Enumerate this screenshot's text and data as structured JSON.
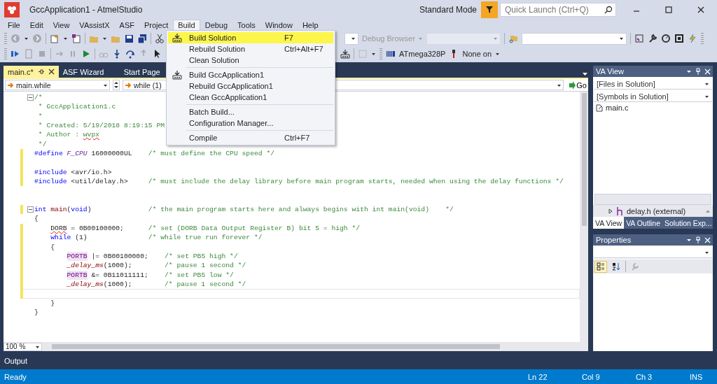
{
  "window": {
    "title": "GccApplication1 - AtmelStudio",
    "mode": "Standard Mode",
    "quick_launch": {
      "placeholder": "Quick Launch (Ctrl+Q)"
    }
  },
  "menu": [
    {
      "label": "File",
      "selected": false
    },
    {
      "label": "Edit",
      "selected": false
    },
    {
      "label": "View",
      "selected": false
    },
    {
      "label": "VAssistX",
      "selected": false
    },
    {
      "label": "ASF",
      "selected": false
    },
    {
      "label": "Project",
      "selected": false
    },
    {
      "label": "Build",
      "selected": true
    },
    {
      "label": "Debug",
      "selected": false
    },
    {
      "label": "Tools",
      "selected": false
    },
    {
      "label": "Window",
      "selected": false
    },
    {
      "label": "Help",
      "selected": false
    }
  ],
  "build_menu": [
    {
      "kind": "icon-item",
      "label": "Build Solution",
      "shortcut": "F7",
      "selected": true
    },
    {
      "kind": "item",
      "label": "Rebuild Solution",
      "shortcut": "Ctrl+Alt+F7",
      "selected": false
    },
    {
      "kind": "item",
      "label": "Clean Solution",
      "selected": false
    },
    {
      "kind": "separator"
    },
    {
      "kind": "icon-item",
      "label": "Build GccApplication1",
      "selected": false
    },
    {
      "kind": "item",
      "label": "Rebuild GccApplication1",
      "selected": false
    },
    {
      "kind": "item",
      "label": "Clean GccApplication1",
      "selected": false
    },
    {
      "kind": "separator"
    },
    {
      "kind": "item",
      "label": "Batch Build...",
      "selected": false
    },
    {
      "kind": "item",
      "label": "Configuration Manager...",
      "selected": false
    },
    {
      "kind": "separator"
    },
    {
      "kind": "item",
      "label": "Compile",
      "shortcut": "Ctrl+F7",
      "selected": false
    }
  ],
  "toolbar": {
    "debug_browser": "Debug Browser",
    "device": "ATmega328P",
    "tool": "None on"
  },
  "document_tabs": [
    {
      "label": "main.c*",
      "selected": true
    },
    {
      "label": "ASF Wizard",
      "selected": false
    },
    {
      "label": "Start Page",
      "selected": false
    }
  ],
  "navigation": {
    "scope": "main.while",
    "member": "while (1)",
    "go": "Go"
  },
  "code": [
    {
      "fold": true,
      "changed": false,
      "current": false,
      "segments": [
        {
          "kind": "comment",
          "text": "/*"
        }
      ]
    },
    {
      "fold": false,
      "changed": false,
      "current": false,
      "segments": [
        {
          "kind": "comment",
          "text": " * GccApplication1.c"
        }
      ]
    },
    {
      "fold": false,
      "changed": false,
      "current": false,
      "segments": [
        {
          "kind": "comment",
          "text": " *"
        }
      ]
    },
    {
      "fold": false,
      "changed": false,
      "current": false,
      "segments": [
        {
          "kind": "comment",
          "text": " * Created: 5/19/2018 8:19:15 PM"
        }
      ]
    },
    {
      "fold": false,
      "changed": false,
      "current": false,
      "segments": [
        {
          "kind": "comment",
          "text": " * Author : "
        },
        {
          "kind": "comment",
          "text": "wvpx",
          "squiggle": true
        }
      ]
    },
    {
      "fold": false,
      "changed": false,
      "current": false,
      "segments": [
        {
          "kind": "comment",
          "text": " */"
        }
      ]
    },
    {
      "fold": false,
      "changed": true,
      "current": false,
      "segments": [
        {
          "kind": "keyword",
          "text": "#define "
        },
        {
          "kind": "macro",
          "text": "F_CPU"
        },
        {
          "kind": "plain",
          "text": " 16000000UL    "
        },
        {
          "kind": "comment",
          "text": "/* must define the CPU speed */"
        }
      ]
    },
    {
      "fold": false,
      "changed": true,
      "current": false
    },
    {
      "fold": false,
      "changed": true,
      "current": false,
      "segments": [
        {
          "kind": "keyword",
          "text": "#include"
        },
        {
          "kind": "plain",
          "text": " <avr/io.h>"
        }
      ]
    },
    {
      "fold": false,
      "changed": true,
      "current": false,
      "segments": [
        {
          "kind": "keyword",
          "text": "#include"
        },
        {
          "kind": "plain",
          "text": " <util/delay.h>     "
        },
        {
          "kind": "comment",
          "text": "/* must include the delay library before main program starts, needed when using the delay functions */"
        }
      ]
    },
    {
      "fold": false,
      "changed": false,
      "current": false
    },
    {
      "fold": false,
      "changed": false,
      "current": false
    },
    {
      "fold": true,
      "changed": true,
      "current": false,
      "segments": [
        {
          "kind": "keyword",
          "text": "int "
        },
        {
          "kind": "function",
          "text": "main"
        },
        {
          "kind": "plain",
          "text": "("
        },
        {
          "kind": "keyword",
          "text": "void"
        },
        {
          "kind": "plain",
          "text": ")              "
        },
        {
          "kind": "comment",
          "text": "/* the main program starts here and always begins with int main(void)    */"
        }
      ]
    },
    {
      "fold": false,
      "changed": false,
      "current": false,
      "segments": [
        {
          "kind": "plain",
          "text": "{"
        }
      ]
    },
    {
      "fold": false,
      "changed": true,
      "current": false,
      "segments": [
        {
          "kind": "plain",
          "text": "    DORB",
          "squiggle": true
        },
        {
          "kind": "plain",
          "text": " = 0B00100000;      "
        },
        {
          "kind": "comment",
          "text": "/* set (DORB Data Output Register B) bit 5 = high */"
        }
      ]
    },
    {
      "fold": false,
      "changed": true,
      "current": false,
      "segments": [
        {
          "kind": "keyword",
          "text": "    while"
        },
        {
          "kind": "plain",
          "text": " (1)               "
        },
        {
          "kind": "comment",
          "text": "/* while true run forever */"
        }
      ]
    },
    {
      "fold": false,
      "changed": true,
      "current": false,
      "segments": [
        {
          "kind": "plain",
          "text": "    {"
        }
      ]
    },
    {
      "fold": false,
      "changed": true,
      "current": false,
      "segments": [
        {
          "kind": "register",
          "text": "        PORTB"
        },
        {
          "kind": "plain",
          "text": " |= 0B00100000;    "
        },
        {
          "kind": "comment",
          "text": "/* set PB5 high */"
        }
      ]
    },
    {
      "fold": false,
      "changed": true,
      "current": false,
      "segments": [
        {
          "kind": "function",
          "text": "        _delay_ms"
        },
        {
          "kind": "plain",
          "text": "(1000);        "
        },
        {
          "kind": "comment",
          "text": "/* pause 1 second */"
        }
      ]
    },
    {
      "fold": false,
      "changed": true,
      "current": false,
      "segments": [
        {
          "kind": "register",
          "text": "        PORTB"
        },
        {
          "kind": "plain",
          "text": " &= 0B11011111;    "
        },
        {
          "kind": "comment",
          "text": "/* set PB5 low */"
        }
      ]
    },
    {
      "fold": false,
      "changed": true,
      "current": false,
      "segments": [
        {
          "kind": "function",
          "text": "        _delay_ms"
        },
        {
          "kind": "plain",
          "text": "(1000);        "
        },
        {
          "kind": "comment",
          "text": "/* pause 1 second */"
        }
      ]
    },
    {
      "fold": false,
      "changed": true,
      "current": true
    },
    {
      "fold": false,
      "changed": false,
      "current": false,
      "segments": [
        {
          "kind": "plain",
          "text": "    }"
        }
      ]
    },
    {
      "fold": false,
      "changed": false,
      "current": false,
      "segments": [
        {
          "kind": "plain",
          "text": "}"
        }
      ]
    }
  ],
  "zoom": "100 %",
  "va_view": {
    "title": "VA View",
    "files_filter": "[Files in Solution]",
    "symbols_filter": "[Symbols in Solution]",
    "files": [
      {
        "name": "main.c"
      }
    ],
    "includes": [
      {
        "name": "delay.h (external)"
      }
    ],
    "tabs": [
      {
        "label": "VA View",
        "selected": true
      },
      {
        "label": "VA Outline",
        "selected": false
      },
      {
        "label": "Solution Exp...",
        "selected": false
      }
    ]
  },
  "properties": {
    "title": "Properties"
  },
  "output_tab": "Output",
  "status_bar": {
    "message": "Ready",
    "line": "Ln 22",
    "column": "Col 9",
    "char": "Ch 3",
    "mode": "INS"
  }
}
